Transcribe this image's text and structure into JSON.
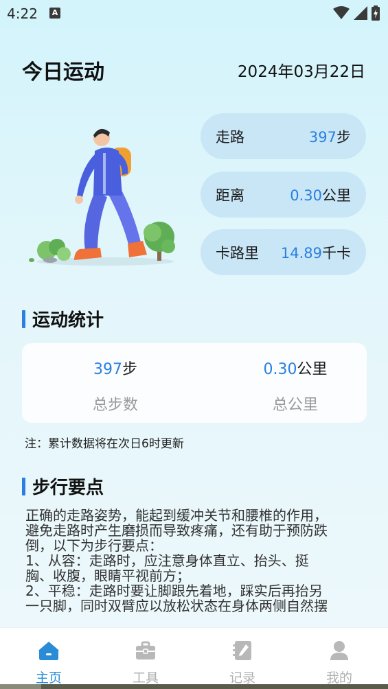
{
  "status_bar": {
    "time": "4:22",
    "badge": "A"
  },
  "header": {
    "title": "今日运动",
    "date": "2024年03月22日"
  },
  "stats_pills": [
    {
      "label": "走路",
      "value": "397",
      "unit": "步"
    },
    {
      "label": "距离",
      "value": "0.30",
      "unit": "公里"
    },
    {
      "label": "卡路里",
      "value": "14.89",
      "unit": "千卡"
    }
  ],
  "section_stats": {
    "title": "运动统计",
    "items": [
      {
        "value": "397",
        "unit": "步",
        "label": "总步数"
      },
      {
        "value": "0.30",
        "unit": "公里",
        "label": "总公里"
      }
    ],
    "note": "注：累计数据将在次日6时更新"
  },
  "section_tips": {
    "title": "步行要点",
    "lines": [
      "正确的走路姿势，能起到缓冲关节和腰椎的作用，",
      "避免走路时产生磨损而导致疼痛，还有助于预防跌",
      "倒，以下为步行要点：",
      "1、从容：走路时，应注意身体直立、抬头、挺",
      "胸、收腹，眼睛平视前方；",
      "2、平稳：走路时要让脚跟先着地，踩实后再抬另",
      "一只脚，同时双臂应以放松状态在身体两侧自然摆"
    ]
  },
  "bottom_nav": {
    "items": [
      {
        "label": "主页",
        "icon": "home-icon",
        "active": true
      },
      {
        "label": "工具",
        "icon": "toolbox-icon",
        "active": false
      },
      {
        "label": "记录",
        "icon": "notebook-icon",
        "active": false
      },
      {
        "label": "我的",
        "icon": "user-icon",
        "active": false
      }
    ]
  },
  "colors": {
    "accent": "#2a7fe0",
    "nav_active": "#2a8bd6",
    "pill_bg": "#c9e6f7"
  }
}
